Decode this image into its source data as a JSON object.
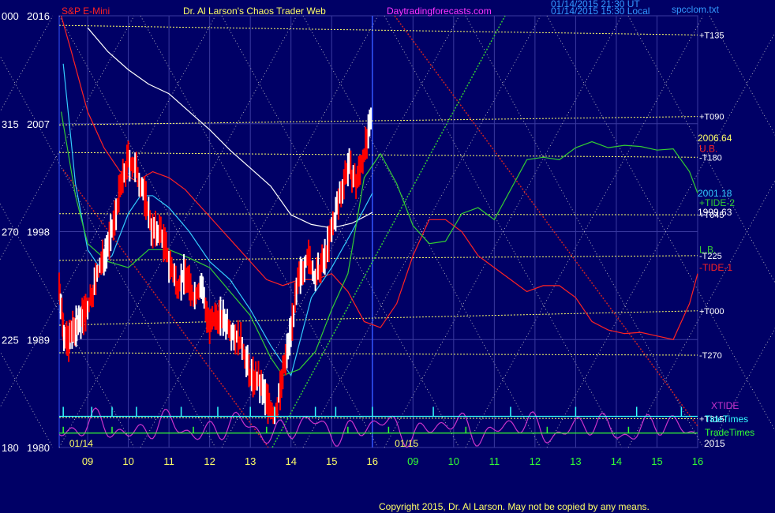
{
  "header": {
    "symbol": "S&P E-Mini",
    "title": "Dr. Al Larson's Chaos Trader Web",
    "site": "Daytradingforecasts.com",
    "timestamp1": "01/14/2015 21:30 UT",
    "timestamp2": "01/14/2015 15:30 Local",
    "file": "spcclom.txt"
  },
  "footer": {
    "copyright": "Copyright 2015, Dr. Al Larson. May not be copied by any means."
  },
  "colors": {
    "background": "#000066",
    "grid": "#3a3aa0",
    "bars": "#ff0000",
    "bars_up": "#ffffff",
    "gold": "#ffff66",
    "red_ma": "#ff2222",
    "green_ma": "#33cc33",
    "cyan_ma": "#33ccff",
    "xtide": "#cc33cc",
    "tide_times": "#33ffff",
    "trade_times": "#33ff33"
  },
  "chart_data": {
    "type": "line",
    "ylim": [
      1980,
      2016
    ],
    "y_ticks": [
      {
        "left": "180",
        "right": "1980",
        "value": 1980
      },
      {
        "left": "225",
        "right": "1989",
        "value": 1989
      },
      {
        "left": "270",
        "right": "1998",
        "value": 1998
      },
      {
        "left": "315",
        "right": "2007",
        "value": 2007
      },
      {
        "left": "000",
        "right": "2016",
        "value": 2016
      }
    ],
    "x_ticks": [
      "09",
      "10",
      "11",
      "12",
      "13",
      "14",
      "15",
      "16",
      "09",
      "10",
      "11",
      "12",
      "13",
      "14",
      "15",
      "16"
    ],
    "x_range": [
      8.3,
      24.0
    ],
    "date_labels": [
      {
        "text": "01/14",
        "x": 8.55
      },
      {
        "text": "01/15",
        "x": 16.55
      }
    ],
    "year_label": "2015",
    "date_divider_x": 16.0,
    "planet_lines": [
      {
        "label": "+T135",
        "values": [
          2015.2,
          2014.4
        ]
      },
      {
        "label": "+T090",
        "values": [
          2006.9,
          2007.6
        ]
      },
      {
        "label": "-T180",
        "values": [
          2004.6,
          2004.2
        ]
      },
      {
        "label": "+T045",
        "values": [
          1999.5,
          1999.4
        ]
      },
      {
        "label": "-T225",
        "values": [
          1995.6,
          1996.0
        ]
      },
      {
        "label": "+T000",
        "values": [
          1990.2,
          1991.4
        ]
      },
      {
        "label": "-T270",
        "values": [
          1987.9,
          1987.7
        ]
      },
      {
        "label": "+T315",
        "values": [
          1982.5,
          1982.4
        ]
      }
    ],
    "price_labels": [
      {
        "text": "2006.64",
        "value": 2005.8,
        "color": "#ffff66"
      },
      {
        "text": "2001.18",
        "value": 2001.2,
        "color": "#33ccff"
      },
      {
        "text": "1999.63",
        "value": 1999.6,
        "color": "#ffffff"
      }
    ],
    "band_labels": [
      {
        "text": "U.B.",
        "value": 2004.9,
        "color": "#ff2222"
      },
      {
        "text": "+TIDE-2",
        "value": 2000.4,
        "color": "#33cc33"
      },
      {
        "text": "L.B.",
        "value": 1996.5,
        "color": "#33cc33"
      },
      {
        "text": "-TIDE-1",
        "value": 1995.0,
        "color": "#ff2222"
      }
    ],
    "legend_bottom": [
      {
        "text": "XTIDE",
        "color": "#cc33cc"
      },
      {
        "text": "TideTimes",
        "color": "#33ffff"
      },
      {
        "text": "TradeTimes",
        "color": "#33ff33"
      }
    ],
    "price_series": {
      "x": [
        8.3,
        8.4,
        8.5,
        8.6,
        8.7,
        8.8,
        8.9,
        9.0,
        9.2,
        9.4,
        9.6,
        9.8,
        10.0,
        10.2,
        10.4,
        10.6,
        10.8,
        11.0,
        11.2,
        11.4,
        11.6,
        11.8,
        12.0,
        12.2,
        12.4,
        12.6,
        12.8,
        13.0,
        13.2,
        13.4,
        13.6,
        13.8,
        14.0,
        14.2,
        14.4,
        14.6,
        14.8,
        15.0,
        15.2,
        15.4,
        15.6,
        15.8,
        16.0
      ],
      "y": [
        1993.5,
        1990,
        1988.5,
        1989.5,
        1990,
        1990.5,
        1991,
        1991.5,
        1994,
        1996,
        1998,
        2001.5,
        2004,
        2003,
        2001,
        1998,
        1998,
        1995.5,
        1993.5,
        1994.5,
        1992.5,
        1993.5,
        1990,
        1991,
        1990.5,
        1989.5,
        1988.5,
        1986,
        1985.5,
        1984,
        1982.5,
        1986,
        1990,
        1994,
        1996,
        1994,
        1995.5,
        1998,
        2001,
        2003.5,
        2002,
        2004.5,
        2007.5
      ]
    },
    "ma_series": [
      {
        "color": "#ff2222",
        "x": [
          8.35,
          8.6,
          9.0,
          9.4,
          9.8,
          10.2,
          10.6,
          11.0,
          11.4,
          11.8,
          12.2,
          12.6,
          13.0,
          13.4,
          13.8,
          14.2,
          14.6,
          15.0,
          15.4,
          15.8,
          16.2,
          16.6,
          17.0,
          17.4,
          17.8,
          18.2,
          18.6,
          19.0,
          19.4,
          19.8,
          20.2,
          20.6,
          21.0,
          21.4,
          21.8,
          22.2,
          22.6,
          23.0,
          23.4,
          23.8,
          24.0
        ],
        "y": [
          2016,
          2013,
          2008,
          2005,
          2003,
          2002.2,
          2003,
          2002.5,
          2001.5,
          2000,
          1998.5,
          1997,
          1995.5,
          1994,
          1993.5,
          1994,
          1994,
          1994.5,
          1993,
          1990.5,
          1990,
          1992,
          1996,
          1999,
          1999,
          1998,
          1996,
          1995,
          1994,
          1993,
          1993.5,
          1993.5,
          1992.5,
          1990.5,
          1989.8,
          1989.5,
          1989.6,
          1989.3,
          1989,
          1992,
          1994.5
        ]
      },
      {
        "color": "#ffffff",
        "x": [
          9.0,
          9.5,
          10.0,
          10.5,
          11.0,
          11.5,
          12.0,
          12.5,
          13.0,
          13.5,
          14.0,
          14.5,
          15.0,
          15.5,
          16.0
        ],
        "y": [
          2015,
          2013,
          2011.5,
          2010.3,
          2009.5,
          2008,
          2006.5,
          2004.8,
          2003.3,
          2001.8,
          1999.4,
          1998.6,
          1998.3,
          1998.7,
          1999.6
        ]
      },
      {
        "color": "#33ccff",
        "x": [
          8.4,
          8.7,
          9.0,
          9.3,
          9.6,
          10.0,
          10.3,
          10.6,
          11.0,
          11.5,
          12.0,
          12.5,
          13.0,
          13.5,
          14.0,
          14.5,
          15.0,
          15.5,
          16.0
        ],
        "y": [
          2012,
          2002,
          1996.5,
          1995,
          1996,
          1999.5,
          2001,
          2001,
          2000,
          1998,
          1995.5,
          1994,
          1991.5,
          1988.5,
          1986,
          1992.5,
          1995,
          1998,
          2001.2
        ]
      },
      {
        "color": "#33cc33",
        "x": [
          8.35,
          8.7,
          9.0,
          9.5,
          10.0,
          10.5,
          11.0,
          11.5,
          12.0,
          12.5,
          13.0,
          13.5,
          13.8,
          14.2,
          14.6,
          15.0,
          15.4,
          15.8,
          16.2,
          16.6,
          17.0,
          17.4,
          17.8,
          18.2,
          18.6,
          19.0,
          19.4,
          19.8,
          20.2,
          20.6,
          21.0,
          21.4,
          21.8,
          22.2,
          22.6,
          23.0,
          23.4,
          23.8,
          24.0
        ],
        "y": [
          2008,
          2001,
          1997,
          1995.5,
          1995,
          1996.5,
          1996.5,
          1995.8,
          1995,
          1993,
          1991,
          1987.5,
          1986,
          1986.5,
          1988,
          1991.5,
          1994.5,
          2002.5,
          2004.5,
          2002,
          1998.5,
          1997,
          1997.2,
          1999.5,
          2000,
          1999,
          2001.5,
          2004,
          2004.2,
          2004,
          2005,
          2005.5,
          2005,
          2005.2,
          2005.1,
          2004.8,
          2004.9,
          2003,
          2001.2
        ]
      }
    ],
    "xtide_baseline": 1981.6,
    "tide_times_level": 1982.6,
    "trade_times_level": 1981.2,
    "tide_times_x": [
      8.4,
      9.1,
      9.6,
      10.2,
      11.3,
      12.2,
      13.0,
      13.6,
      14.6,
      15.1,
      16.0,
      17.5,
      19.4,
      21.0,
      22.5,
      23.6
    ],
    "trade_times_x": [
      8.4,
      9.6,
      11.6,
      13.4,
      15.4,
      16.4,
      18.3,
      20.3,
      22.3
    ]
  }
}
